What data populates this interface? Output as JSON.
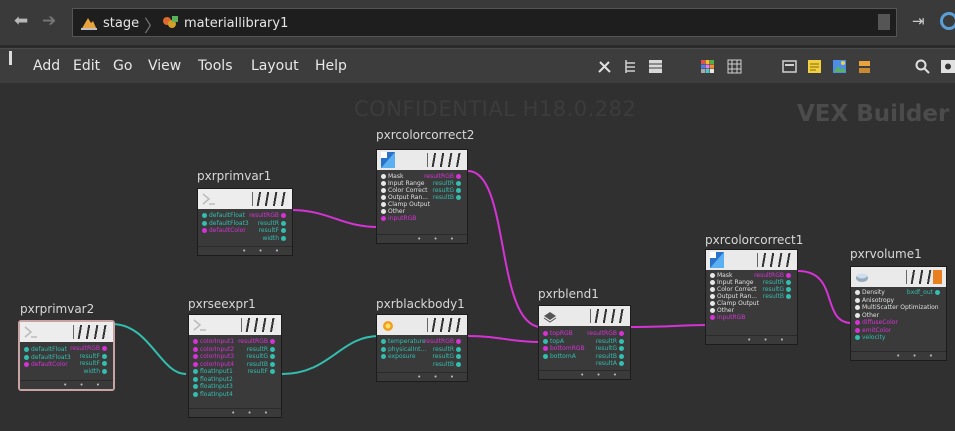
{
  "path": {
    "crumb1": "stage",
    "crumb2": "materiallibrary1"
  },
  "menu": [
    "Add",
    "Edit",
    "Go",
    "View",
    "Tools",
    "Layout",
    "Help"
  ],
  "watermark": {
    "left": "CONFIDENTIAL H18.0.282",
    "right": "VEX Builder"
  },
  "colors": {
    "magenta": "#d633d6",
    "teal": "#33bfb0",
    "white": "#e8e8e8",
    "selected_border": "#c8a3a3"
  },
  "nodes": {
    "pxrprimvar1": {
      "title": "pxrprimvar1",
      "inputs": [
        {
          "label": "defaultFloat",
          "type": "teal"
        },
        {
          "label": "defaultFloat3",
          "type": "teal"
        },
        {
          "label": "defaultColor",
          "type": "magenta"
        }
      ],
      "outputs": [
        {
          "label": "resultRGB",
          "type": "magenta"
        },
        {
          "label": "resultR",
          "type": "teal"
        },
        {
          "label": "resultF",
          "type": "teal"
        },
        {
          "label": "width",
          "type": "teal"
        }
      ],
      "footer": "• • •"
    },
    "pxrprimvar2": {
      "title": "pxrprimvar2",
      "inputs": [
        {
          "label": "defaultFloat",
          "type": "teal"
        },
        {
          "label": "defaultFloat3",
          "type": "teal"
        },
        {
          "label": "defaultColor",
          "type": "magenta"
        }
      ],
      "outputs": [
        {
          "label": "resultRGB",
          "type": "magenta"
        },
        {
          "label": "resultF",
          "type": "teal"
        },
        {
          "label": "resultF",
          "type": "teal"
        },
        {
          "label": "width",
          "type": "teal"
        }
      ],
      "footer": "• • •"
    },
    "pxrseexpr1": {
      "title": "pxrseexpr1",
      "inputs": [
        {
          "label": "colorInput1",
          "type": "magenta"
        },
        {
          "label": "colorInput2",
          "type": "magenta"
        },
        {
          "label": "colorInput3",
          "type": "magenta"
        },
        {
          "label": "colorInput4",
          "type": "magenta"
        },
        {
          "label": "floatInput1",
          "type": "teal"
        },
        {
          "label": "floatInput2",
          "type": "teal"
        },
        {
          "label": "floatInput3",
          "type": "teal"
        },
        {
          "label": "floatInput4",
          "type": "teal"
        }
      ],
      "outputs": [
        {
          "label": "resultRGB",
          "type": "magenta"
        },
        {
          "label": "resultR",
          "type": "teal"
        },
        {
          "label": "resultG",
          "type": "teal"
        },
        {
          "label": "resultB",
          "type": "teal"
        },
        {
          "label": "resultF",
          "type": "teal"
        }
      ],
      "footer": "• • •"
    },
    "pxrcolorcorrect2": {
      "title": "pxrcolorcorrect2",
      "inputs": [
        {
          "label": "Mask",
          "type": "white"
        },
        {
          "label": "Input Range",
          "type": "white"
        },
        {
          "label": "Color Correct",
          "type": "white"
        },
        {
          "label": "Output Ran...",
          "type": "white"
        },
        {
          "label": "Clamp Output",
          "type": "white"
        },
        {
          "label": "Other",
          "type": "white"
        },
        {
          "label": "inputRGB",
          "type": "magenta"
        }
      ],
      "outputs": [
        {
          "label": "resultRGB",
          "type": "magenta"
        },
        {
          "label": "resultR",
          "type": "teal"
        },
        {
          "label": "resultG",
          "type": "teal"
        },
        {
          "label": "resultB",
          "type": "teal"
        }
      ],
      "footer": "• • •"
    },
    "pxrblackbody1": {
      "title": "pxrblackbody1",
      "inputs": [
        {
          "label": "temperature",
          "type": "teal"
        },
        {
          "label": "physicalInt...",
          "type": "teal"
        },
        {
          "label": "exposure",
          "type": "teal"
        }
      ],
      "outputs": [
        {
          "label": "resultRGB",
          "type": "magenta"
        },
        {
          "label": "resultR",
          "type": "teal"
        },
        {
          "label": "resultG",
          "type": "teal"
        },
        {
          "label": "resultB",
          "type": "teal"
        }
      ],
      "footer": "• • •"
    },
    "pxrblend1": {
      "title": "pxrblend1",
      "inputs": [
        {
          "label": "topRGB",
          "type": "magenta"
        },
        {
          "label": "topA",
          "type": "teal"
        },
        {
          "label": "bottomRGB",
          "type": "magenta"
        },
        {
          "label": "bottomA",
          "type": "teal"
        }
      ],
      "outputs": [
        {
          "label": "resultRGB",
          "type": "magenta"
        },
        {
          "label": "resultR",
          "type": "teal"
        },
        {
          "label": "resultG",
          "type": "teal"
        },
        {
          "label": "resultB",
          "type": "teal"
        },
        {
          "label": "resultA",
          "type": "teal"
        }
      ],
      "footer": "• • •"
    },
    "pxrcolorcorrect1": {
      "title": "pxrcolorcorrect1",
      "inputs": [
        {
          "label": "Mask",
          "type": "white"
        },
        {
          "label": "Input Range",
          "type": "white"
        },
        {
          "label": "Color Correct",
          "type": "white"
        },
        {
          "label": "Output Ran...",
          "type": "white"
        },
        {
          "label": "Clamp Output",
          "type": "white"
        },
        {
          "label": "Other",
          "type": "white"
        },
        {
          "label": "inputRGB",
          "type": "magenta"
        }
      ],
      "outputs": [
        {
          "label": "resultRGB",
          "type": "magenta"
        },
        {
          "label": "resultR",
          "type": "teal"
        },
        {
          "label": "resultG",
          "type": "teal"
        },
        {
          "label": "resultB",
          "type": "teal"
        }
      ],
      "footer": "• • •"
    },
    "pxrvolume1": {
      "title": "pxrvolume1",
      "inputs": [
        {
          "label": "Density",
          "type": "white"
        },
        {
          "label": "Anisotropy",
          "type": "white"
        },
        {
          "label": "MultiScatter Optimization",
          "type": "white"
        },
        {
          "label": "Other",
          "type": "white"
        },
        {
          "label": "diffuseColor",
          "type": "magenta"
        },
        {
          "label": "emitColor",
          "type": "magenta"
        },
        {
          "label": "velocity",
          "type": "teal"
        }
      ],
      "outputs": [
        {
          "label": "bxdf_out",
          "type": "teal"
        }
      ],
      "footer": "• • •"
    }
  }
}
